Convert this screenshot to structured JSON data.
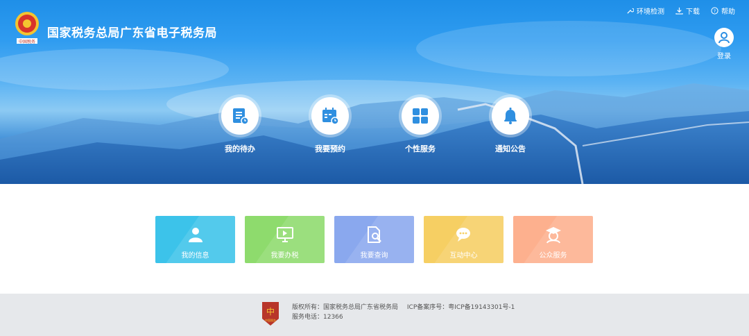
{
  "site": {
    "title": "国家税务总局广东省电子税务局",
    "logo_caption": "中国税务"
  },
  "top_links": [
    {
      "label": "环境检测",
      "icon": "tools-icon"
    },
    {
      "label": "下载",
      "icon": "download-icon"
    },
    {
      "label": "帮助",
      "icon": "help-icon"
    }
  ],
  "login": {
    "label": "登录",
    "icon": "user-avatar-icon"
  },
  "nav": [
    {
      "label": "我的待办",
      "icon": "todo-document-icon"
    },
    {
      "label": "我要预约",
      "icon": "calendar-clock-icon"
    },
    {
      "label": "个性服务",
      "icon": "grid-apps-icon"
    },
    {
      "label": "通知公告",
      "icon": "bell-icon"
    }
  ],
  "tiles": [
    {
      "label": "我的信息",
      "icon": "user-icon",
      "color": "#3cc3ea"
    },
    {
      "label": "我要办税",
      "icon": "monitor-icon",
      "color": "#8edb6d"
    },
    {
      "label": "我要查询",
      "icon": "document-search-icon",
      "color": "#8aa8ee"
    },
    {
      "label": "互动中心",
      "icon": "chat-bubbles-icon",
      "color": "#f6cf63"
    },
    {
      "label": "公众服务",
      "icon": "graduate-icon",
      "color": "#fdb08e"
    }
  ],
  "footer": {
    "copyright": "版权所有：国家税务总局广东省税务局",
    "icp": "ICP备案序号：粤ICP备19143301号-1",
    "phone": "服务电话：12366",
    "emblem_caption": "中国税务"
  }
}
